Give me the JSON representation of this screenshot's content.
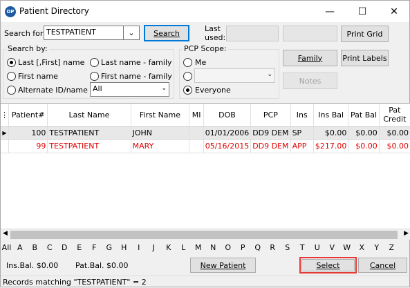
{
  "window": {
    "title": "Patient Directory",
    "minimize_label": "—",
    "maximize_label": "☐",
    "close_label": "✕"
  },
  "search": {
    "label": "Search for:",
    "value": "TESTPATIENT",
    "button": "Search",
    "last_used_label": "Last used:"
  },
  "search_by": {
    "label": "Search by:",
    "opt1": "Last [,First] name",
    "opt2": "Last name - family",
    "opt3": "First name",
    "opt4": "First name - family",
    "opt5": "Alternate ID/name",
    "filter_value": "All"
  },
  "pcp": {
    "label": "PCP Scope:",
    "me": "Me",
    "everyone": "Everyone"
  },
  "buttons": {
    "print_grid": "Print Grid",
    "family": "Family",
    "print_labels": "Print Labels",
    "notes": "Notes"
  },
  "columns": [
    "Patient#",
    "Last Name",
    "First Name",
    "MI",
    "DOB",
    "PCP",
    "Ins",
    "Ins Bal",
    "Pat Bal",
    "Pat Credit"
  ],
  "rows": [
    {
      "num": "100",
      "last": "TESTPATIENT",
      "first": "JOHN",
      "mi": "",
      "dob": "01/01/2006",
      "pcp": "DD9 DEM",
      "ins": "SP",
      "ins_bal": "$0.00",
      "pat_bal": "$0.00",
      "credit": "$0.00"
    },
    {
      "num": "99",
      "last": "TESTPATIENT",
      "first": "MARY",
      "mi": "",
      "dob": "05/16/2015",
      "pcp": "DD9 DEM",
      "ins": "APP",
      "ins_bal": "$217.00",
      "pat_bal": "$0.00",
      "credit": "$0.00"
    }
  ],
  "alphabet": [
    "All",
    "A",
    "B",
    "C",
    "D",
    "E",
    "F",
    "G",
    "H",
    "I",
    "J",
    "K",
    "L",
    "M",
    "N",
    "O",
    "P",
    "Q",
    "R",
    "S",
    "T",
    "U",
    "V",
    "W",
    "X",
    "Y",
    "Z"
  ],
  "footer": {
    "ins_bal": "Ins.Bal. $0.00",
    "pat_bal": "Pat.Bal. $0.00",
    "new_patient": "New Patient",
    "select": "Select",
    "cancel": "Cancel"
  },
  "status": "Records matching \"TESTPATIENT\" = 2",
  "colors": {
    "accent": "#0078d7",
    "highlight": "#e53935",
    "red_text": "#e00000"
  }
}
